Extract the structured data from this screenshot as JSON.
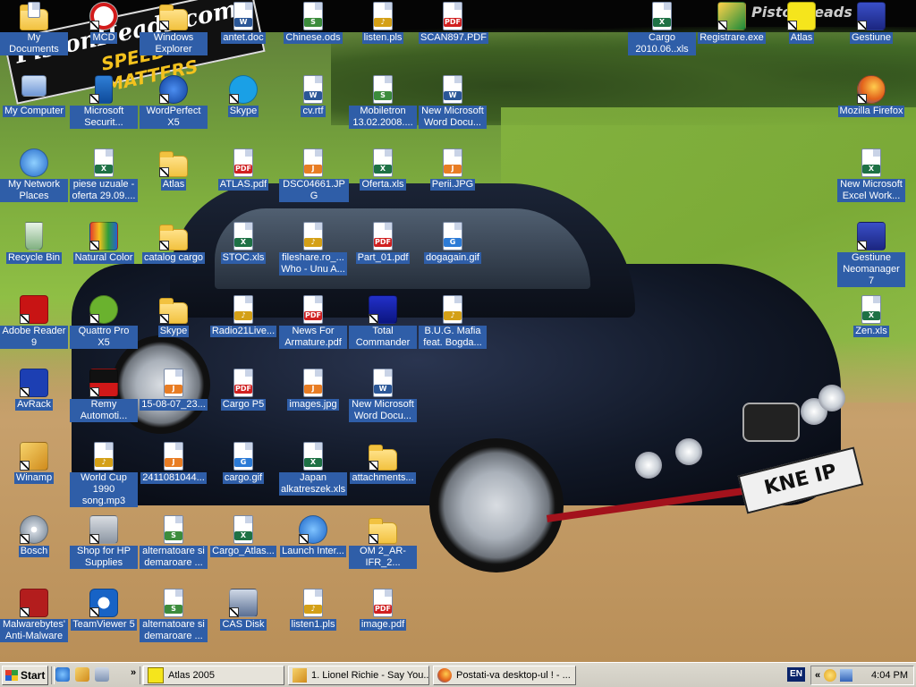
{
  "desktop": {
    "icons": [
      {
        "label": "My Documents",
        "kind": "folder-doc",
        "plain": false
      },
      {
        "label": "MCD",
        "kind": "app-mcd",
        "plain": false
      },
      {
        "label": "Windows Explorer",
        "kind": "folder",
        "plain": false
      },
      {
        "label": "antet.doc",
        "kind": "word",
        "plain": false
      },
      {
        "label": "Chinese.ods",
        "kind": "ods",
        "plain": false
      },
      {
        "label": "listen.pls",
        "kind": "pls",
        "plain": false
      },
      {
        "label": "SCAN897.PDF",
        "kind": "pdf",
        "plain": false
      },
      {
        "label": "Cargo 2010.06..xls",
        "kind": "xls",
        "plain": false
      },
      {
        "label": "Registrare.exe",
        "kind": "app-reg",
        "plain": false
      },
      {
        "label": "Atlas",
        "kind": "app-atlas",
        "plain": false
      },
      {
        "label": "Gestiune",
        "kind": "app-gest",
        "plain": false
      },
      {
        "label": "My Computer",
        "kind": "computer",
        "plain": false
      },
      {
        "label": "Microsoft Securit...",
        "kind": "app-mse",
        "plain": false
      },
      {
        "label": "WordPerfect X5",
        "kind": "app-wp",
        "plain": false
      },
      {
        "label": "Skype",
        "kind": "app-skype",
        "plain": false
      },
      {
        "label": "cv.rtf",
        "kind": "word",
        "plain": false
      },
      {
        "label": "Mobiletron 13.02.2008....",
        "kind": "ods",
        "plain": false
      },
      {
        "label": "New Microsoft Word Docu...",
        "kind": "word",
        "plain": false
      },
      {
        "label": "Mozilla Firefox",
        "kind": "app-firefox",
        "plain": false
      },
      {
        "label": "My Network Places",
        "kind": "network",
        "plain": false
      },
      {
        "label": "piese uzuale - oferta 29.09....",
        "kind": "xls",
        "plain": false
      },
      {
        "label": "Atlas",
        "kind": "folder",
        "plain": false
      },
      {
        "label": "ATLAS.pdf",
        "kind": "pdf",
        "plain": false
      },
      {
        "label": "DSC04661.JPG",
        "kind": "jpg",
        "plain": false
      },
      {
        "label": "Oferta.xls",
        "kind": "xls",
        "plain": false
      },
      {
        "label": "Perii.JPG",
        "kind": "jpg",
        "plain": false
      },
      {
        "label": "New Microsoft Excel Work...",
        "kind": "xls",
        "plain": false
      },
      {
        "label": "Recycle Bin",
        "kind": "recycle",
        "plain": false
      },
      {
        "label": "Natural Color",
        "kind": "app-nc",
        "plain": false
      },
      {
        "label": "catalog cargo",
        "kind": "folder",
        "plain": false
      },
      {
        "label": "STOC.xls",
        "kind": "xls",
        "plain": false
      },
      {
        "label": "fileshare.ro_... Who - Unu A...",
        "kind": "pls",
        "plain": false
      },
      {
        "label": "Part_01.pdf",
        "kind": "pdf",
        "plain": false
      },
      {
        "label": "dogagain.gif",
        "kind": "gif",
        "plain": false
      },
      {
        "label": "Gestiune Neomanager 7",
        "kind": "app-gest",
        "plain": false
      },
      {
        "label": "Adobe Reader 9",
        "kind": "app-adobe",
        "plain": false
      },
      {
        "label": "Quattro Pro X5",
        "kind": "app-qp",
        "plain": false
      },
      {
        "label": "Skype",
        "kind": "folder",
        "plain": false
      },
      {
        "label": "Radio21Live...",
        "kind": "pls",
        "plain": false
      },
      {
        "label": "News For Armature.pdf",
        "kind": "pdf",
        "plain": false
      },
      {
        "label": "Total Commander",
        "kind": "app-tc",
        "plain": false
      },
      {
        "label": "B.U.G. Mafia feat. Bogda...",
        "kind": "pls",
        "plain": false
      },
      {
        "label": "Zen.xls",
        "kind": "xls",
        "plain": false
      },
      {
        "label": "AvRack",
        "kind": "app-avrack",
        "plain": false
      },
      {
        "label": "Remy Automoti...",
        "kind": "app-remy",
        "plain": false
      },
      {
        "label": "15-08-07_23...",
        "kind": "jpg",
        "plain": false
      },
      {
        "label": "Cargo P5",
        "kind": "pdf",
        "plain": false
      },
      {
        "label": "images.jpg",
        "kind": "jpg",
        "plain": false
      },
      {
        "label": "New Microsoft Word Docu...",
        "kind": "word",
        "plain": false
      },
      {
        "label": "Winamp",
        "kind": "app-winamp",
        "plain": false
      },
      {
        "label": "World Cup 1990 song.mp3",
        "kind": "pls",
        "plain": false
      },
      {
        "label": "2411081044...",
        "kind": "jpg",
        "plain": false
      },
      {
        "label": "cargo.gif",
        "kind": "gif",
        "plain": false
      },
      {
        "label": "Japan alkatreszek.xls",
        "kind": "xls",
        "plain": false
      },
      {
        "label": "attachments...",
        "kind": "folder",
        "plain": false
      },
      {
        "label": "Bosch",
        "kind": "app-cd",
        "plain": false
      },
      {
        "label": "Shop for HP Supplies",
        "kind": "app-hp",
        "plain": false
      },
      {
        "label": "alternatoare si demaroare ...",
        "kind": "ods",
        "plain": false
      },
      {
        "label": "Cargo_Atlas...",
        "kind": "xls",
        "plain": false
      },
      {
        "label": "Launch Inter...",
        "kind": "app-ie",
        "plain": false
      },
      {
        "label": "OM 2_AR-IFR_2...",
        "kind": "folder",
        "plain": false
      },
      {
        "label": "Malwarebytes' Anti-Malware",
        "kind": "app-mbam",
        "plain": false
      },
      {
        "label": "TeamViewer 5",
        "kind": "app-tv",
        "plain": false
      },
      {
        "label": "alternatoare si demaroare ...",
        "kind": "ods",
        "plain": false
      },
      {
        "label": "CAS Disk",
        "kind": "app-cas",
        "plain": false
      },
      {
        "label": "listen1.pls",
        "kind": "pls",
        "plain": false
      },
      {
        "label": "image.pdf",
        "kind": "pdf",
        "plain": false
      }
    ],
    "wallpaper": {
      "logo_text_1": "PistonHeads.com",
      "logo_text_2": "SPEED MATTERS",
      "logo_text_right": "PistonHeads",
      "plate_text": "KNE IP"
    }
  },
  "taskbar": {
    "start_label": "Start",
    "quick_launch_icons": [
      "ie-icon",
      "winamp-icon",
      "show-desktop-icon"
    ],
    "more_label": "»",
    "buttons": [
      {
        "label": "Atlas 2005",
        "icon": "atlas-icon"
      },
      {
        "label": "1. Lionel Richie - Say You...",
        "icon": "winamp-icon"
      },
      {
        "label": "Postati-va desktop-ul ! - ...",
        "icon": "firefox-icon"
      }
    ],
    "language": "EN",
    "tray_expand": "«",
    "clock": "4:04 PM"
  }
}
